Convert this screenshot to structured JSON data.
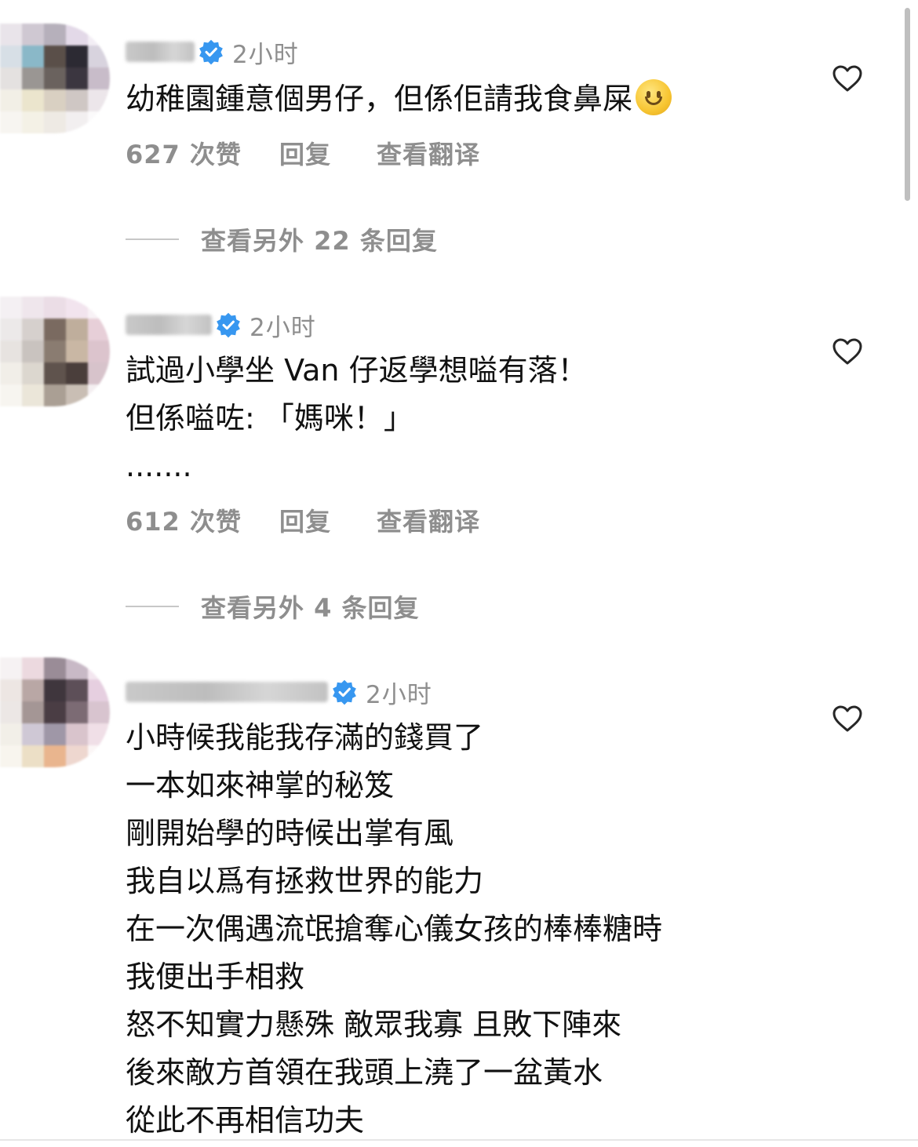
{
  "comments": [
    {
      "time": "2小时",
      "lines": [
        "幼稚園鍾意個男仔，但係佢請我食鼻屎"
      ],
      "emoji": "slightly-smiling-face",
      "likes": "627 次赞",
      "reply_label": "回复",
      "translate_label": "查看翻译",
      "more_replies": "查看另外 22 条回复"
    },
    {
      "time": "2小时",
      "lines": [
        "試過小學坐 Van 仔返學想嗌有落！",
        "但係嗌咗: 「媽咪！」",
        "......."
      ],
      "likes": "612 次赞",
      "reply_label": "回复",
      "translate_label": "查看翻译",
      "more_replies": "查看另外 4 条回复"
    },
    {
      "time": "2小时",
      "lines": [
        "小時候我能我存滿的錢買了",
        "一本如來神掌的秘笈",
        "剛開始學的時候出掌有風",
        "我自以爲有拯救世界的能力",
        "在一次偶遇流氓搶奪心儀女孩的棒棒糖時",
        "我便出手相救",
        "怒不知實力懸殊 敵眾我寡 且敗下陣來",
        "後來敵方首領在我頭上澆了一盆黃水",
        "從此不再相信功夫"
      ]
    }
  ],
  "icons": {
    "verified": "verified-badge-icon",
    "like": "heart-icon"
  },
  "colors": {
    "verified": "#3797f0",
    "muted": "#8e8e8e",
    "text": "#111111"
  }
}
